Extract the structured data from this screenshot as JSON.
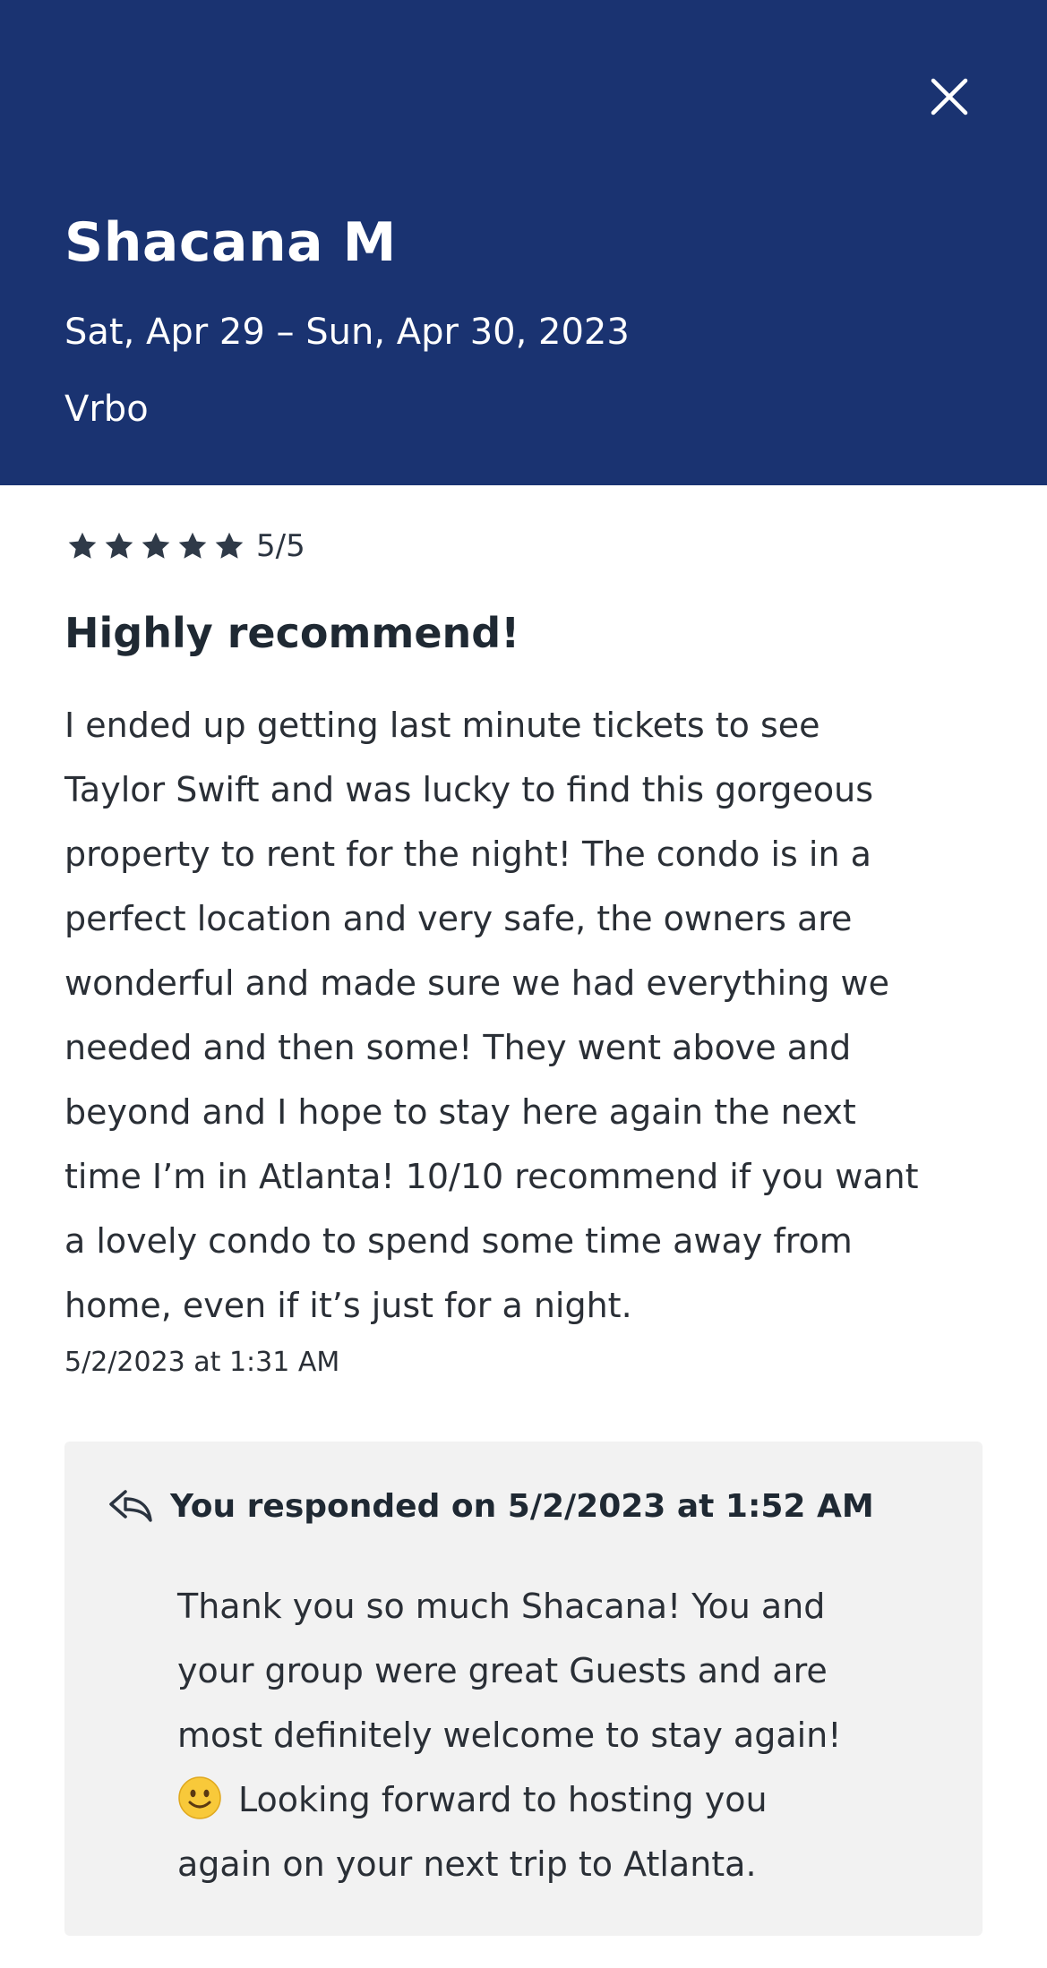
{
  "header": {
    "guest_name": "Shacana M",
    "stay_dates": "Sat, Apr 29 – Sun, Apr 30, 2023",
    "source": "Vrbo",
    "background_color": "#1a3371",
    "close_icon": "close-icon"
  },
  "review": {
    "rating_stars": 5,
    "rating_text": "5/5",
    "title": "Highly recommend!",
    "body_lines": [
      "I ended up getting last minute tickets to see",
      "Taylor Swift and was lucky to find this gorgeous",
      "property to rent for the night! The condo is in a",
      "perfect location and very safe, the owners are",
      "wonderful and made sure we had everything we",
      "needed and then some! They went above and",
      "beyond and I hope to stay here again the next",
      "time I’m in Atlanta! 10/10 recommend if you want",
      "a lovely condo to spend some time away from",
      "home, even if it’s just for a night."
    ],
    "timestamp": "5/2/2023 at 1:31 AM"
  },
  "response": {
    "icon": "reply-arrow-icon",
    "heading": "You responded on 5/2/2023 at 1:52 AM",
    "body_lines": [
      "Thank you so much Shacana! You and",
      "your group were great Guests and are",
      "most definitely welcome to stay again!",
      "Looking forward to hosting you",
      "again on your next trip to Atlanta."
    ],
    "emoji": "slightly-smiling-face"
  }
}
